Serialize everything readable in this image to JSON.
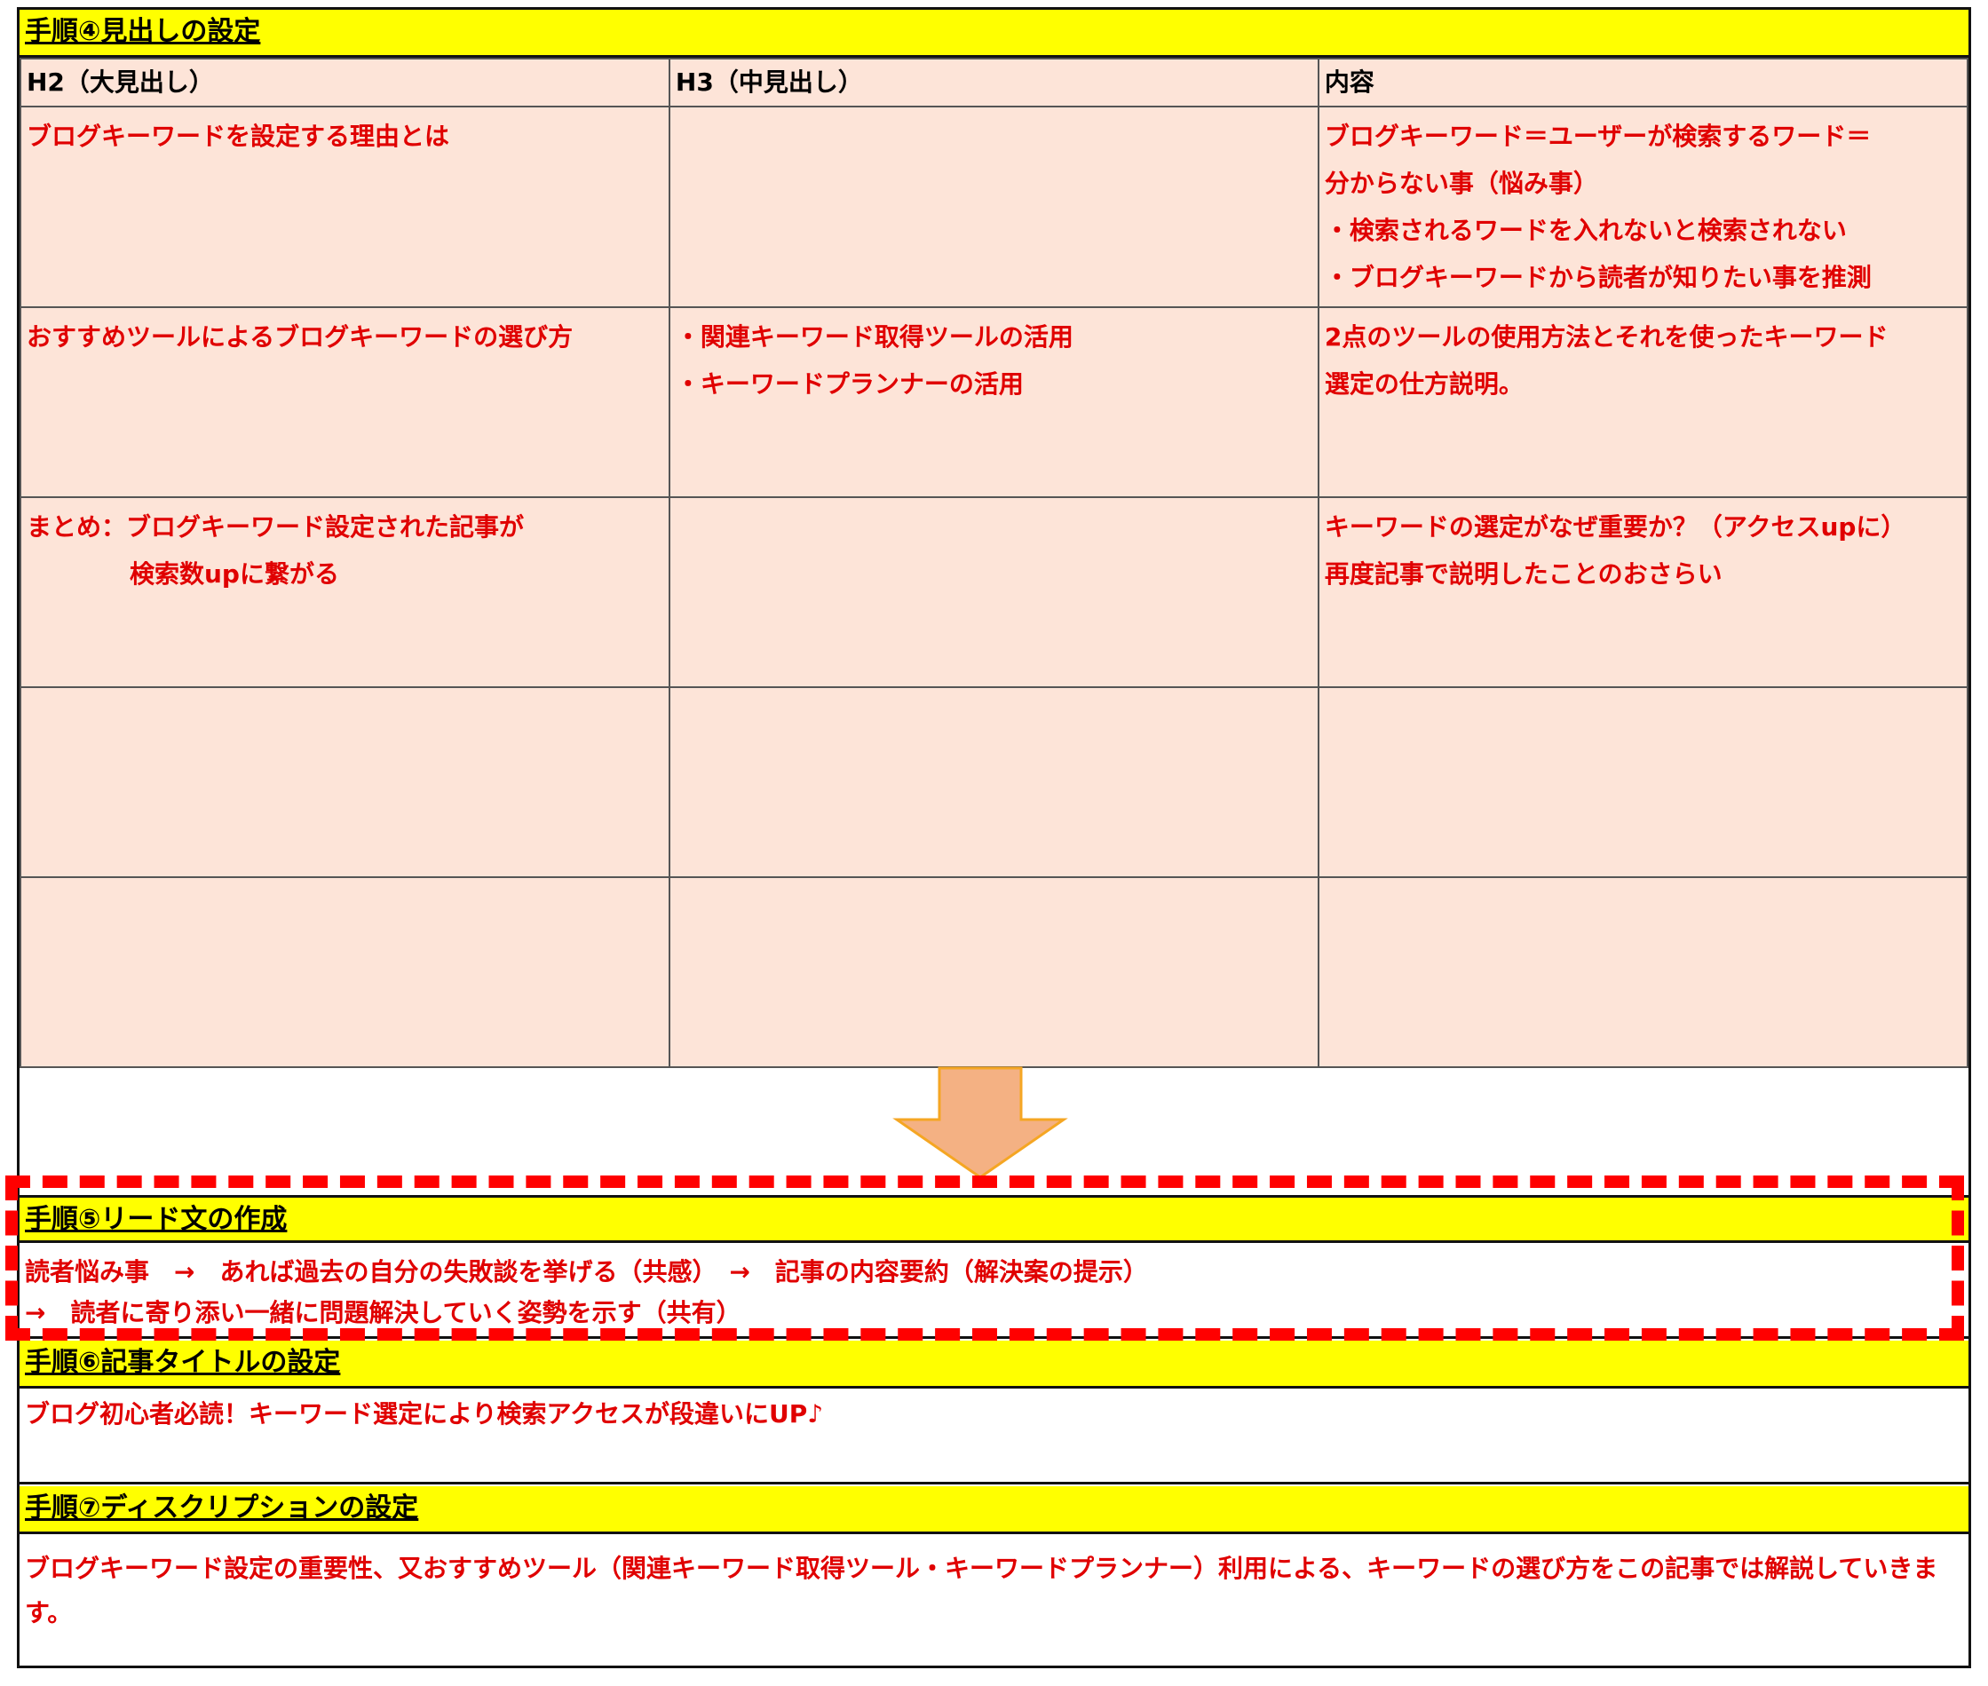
{
  "step4": {
    "title": "手順④見出しの設定",
    "headers": [
      "H2（大見出し）",
      "H3（中見出し）",
      "内容"
    ],
    "rows": [
      {
        "h2": [
          "ブログキーワードを設定する理由とは"
        ],
        "h3": [],
        "content": [
          "ブログキーワード＝ユーザーが検索するワード＝",
          "分からない事（悩み事）",
          "・検索されるワードを入れないと検索されない",
          "・ブログキーワードから読者が知りたい事を推測"
        ]
      },
      {
        "h2": [
          "おすすめツールによるブログキーワードの選び方"
        ],
        "h3": [
          "・関連キーワード取得ツールの活用",
          "・キーワードプランナーの活用"
        ],
        "content": [
          "2点のツールの使用方法とそれを使ったキーワード",
          "選定の仕方説明。"
        ]
      },
      {
        "h2": [
          "まとめ：ブログキーワード設定された記事が",
          "検索数upに繋がる"
        ],
        "h3": [],
        "content": [
          "キーワードの選定がなぜ重要か？（アクセスupに）",
          "再度記事で説明したことのおさらい"
        ]
      },
      {
        "h2": [],
        "h3": [],
        "content": []
      },
      {
        "h2": [],
        "h3": [],
        "content": []
      }
    ]
  },
  "step5": {
    "title": "手順⑤リード文の作成",
    "lines": [
      "読者悩み事　→　あれば過去の自分の失敗談を挙げる（共感）　→　記事の内容要約（解決案の提示）",
      "→　読者に寄り添い一緒に問題解決していく姿勢を示す（共有）"
    ]
  },
  "step6": {
    "title": "手順⑥記事タイトルの設定",
    "text": "ブログ初心者必読！キーワード選定により検索アクセスが段違いにUP♪"
  },
  "step7": {
    "title": "手順⑦ディスクリプションの設定",
    "text": "ブログキーワード設定の重要性、又おすすめツール（関連キーワード取得ツール・キーワードプランナー）利用による、キーワードの選び方をこの記事では解説していきます。"
  },
  "colors": {
    "yellow": "#ffff00",
    "cell": "#fde4d8",
    "red": "#e00000",
    "arrow": "#f4b183",
    "dash": "#ff0000"
  },
  "icons": {
    "arrow": "down-arrow-icon"
  }
}
